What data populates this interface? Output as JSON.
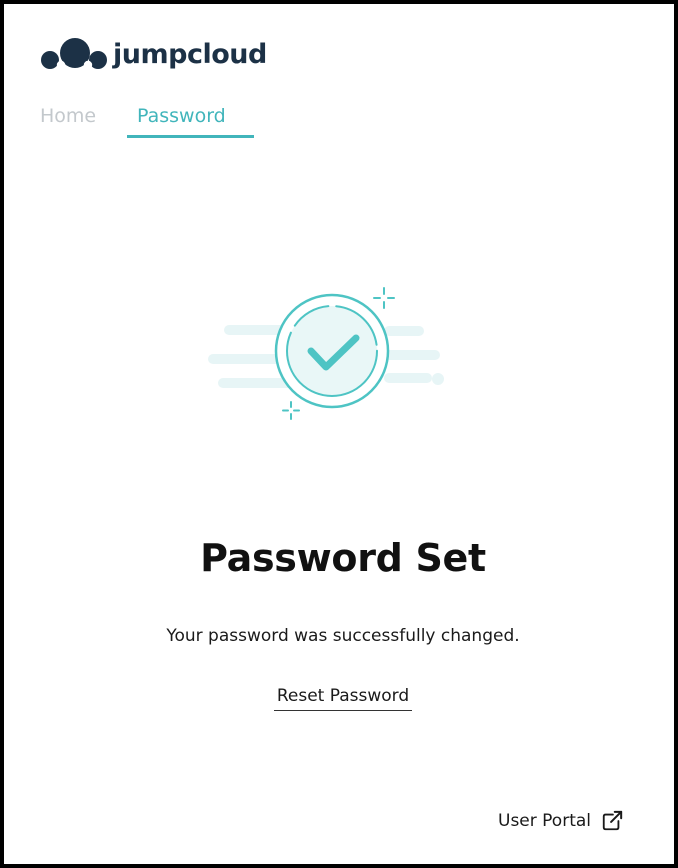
{
  "brand": {
    "name": "jumpcloud",
    "icon": "cloud-logo-icon",
    "color": "#1c3146"
  },
  "nav": {
    "tabs": [
      {
        "label": "Home",
        "active": false
      },
      {
        "label": "Password",
        "active": true
      }
    ],
    "accent_color": "#41b5bb"
  },
  "main": {
    "illustration": "success-checkmark-icon",
    "title": "Password Set",
    "message": "Your password was successfully changed.",
    "reset_link": "Reset Password"
  },
  "footer": {
    "user_portal_label": "User Portal",
    "icon": "external-link-icon"
  }
}
